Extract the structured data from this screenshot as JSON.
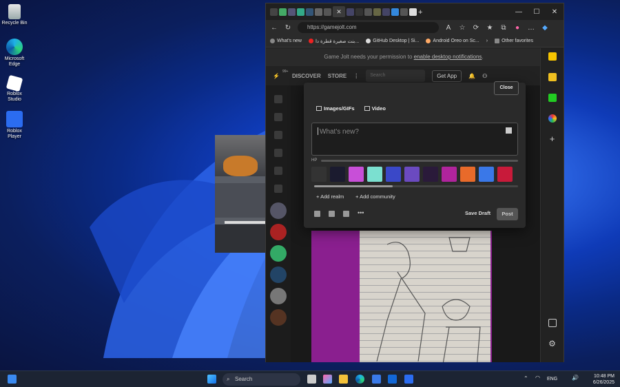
{
  "desktop": {
    "icons": [
      {
        "label": "Recycle Bin",
        "icon": "recycle-bin-icon"
      },
      {
        "label": "Microsoft Edge",
        "icon": "edge-icon"
      },
      {
        "label": "Roblox Studio",
        "icon": "roblox-studio-icon"
      },
      {
        "label": "Roblox Player",
        "icon": "roblox-player-icon"
      }
    ]
  },
  "browser": {
    "url": "https://gamejolt.com",
    "favorites": [
      "What's new",
      "بنت صغيرة قطرة دا...",
      "GitHub Desktop | Si...",
      "Android Oreo on Sc..."
    ],
    "other_favorites": "Other favorites"
  },
  "gamejolt": {
    "notification": "Game Jolt needs your permission to ",
    "notification_link": "enable desktop notifications",
    "notification_end": ".",
    "badge": "99+",
    "nav": {
      "discover": "DISCOVER",
      "store": "STORE",
      "search_placeholder": "Search",
      "get_app": "Get App"
    }
  },
  "post_modal": {
    "close": "Close",
    "images_tab": "Images/GIFs",
    "video_tab": "Video",
    "placeholder": "What's new?",
    "hp_label": "HP",
    "add_realm": "Add realm",
    "add_community": "Add community",
    "save_draft": "Save Draft",
    "post": "Post",
    "backgrounds": [
      "#333333",
      "#1b1b2f",
      "#c84fd8",
      "#7be0d0",
      "#3a48c8",
      "#6b4ac0",
      "#2a1a3a",
      "#b0249c",
      "#e86a2a",
      "#3a78e8",
      "#c81a3a"
    ]
  },
  "taskbar": {
    "search": "Search",
    "language": "ENG",
    "time": "10:48 PM",
    "date": "6/26/2025"
  }
}
